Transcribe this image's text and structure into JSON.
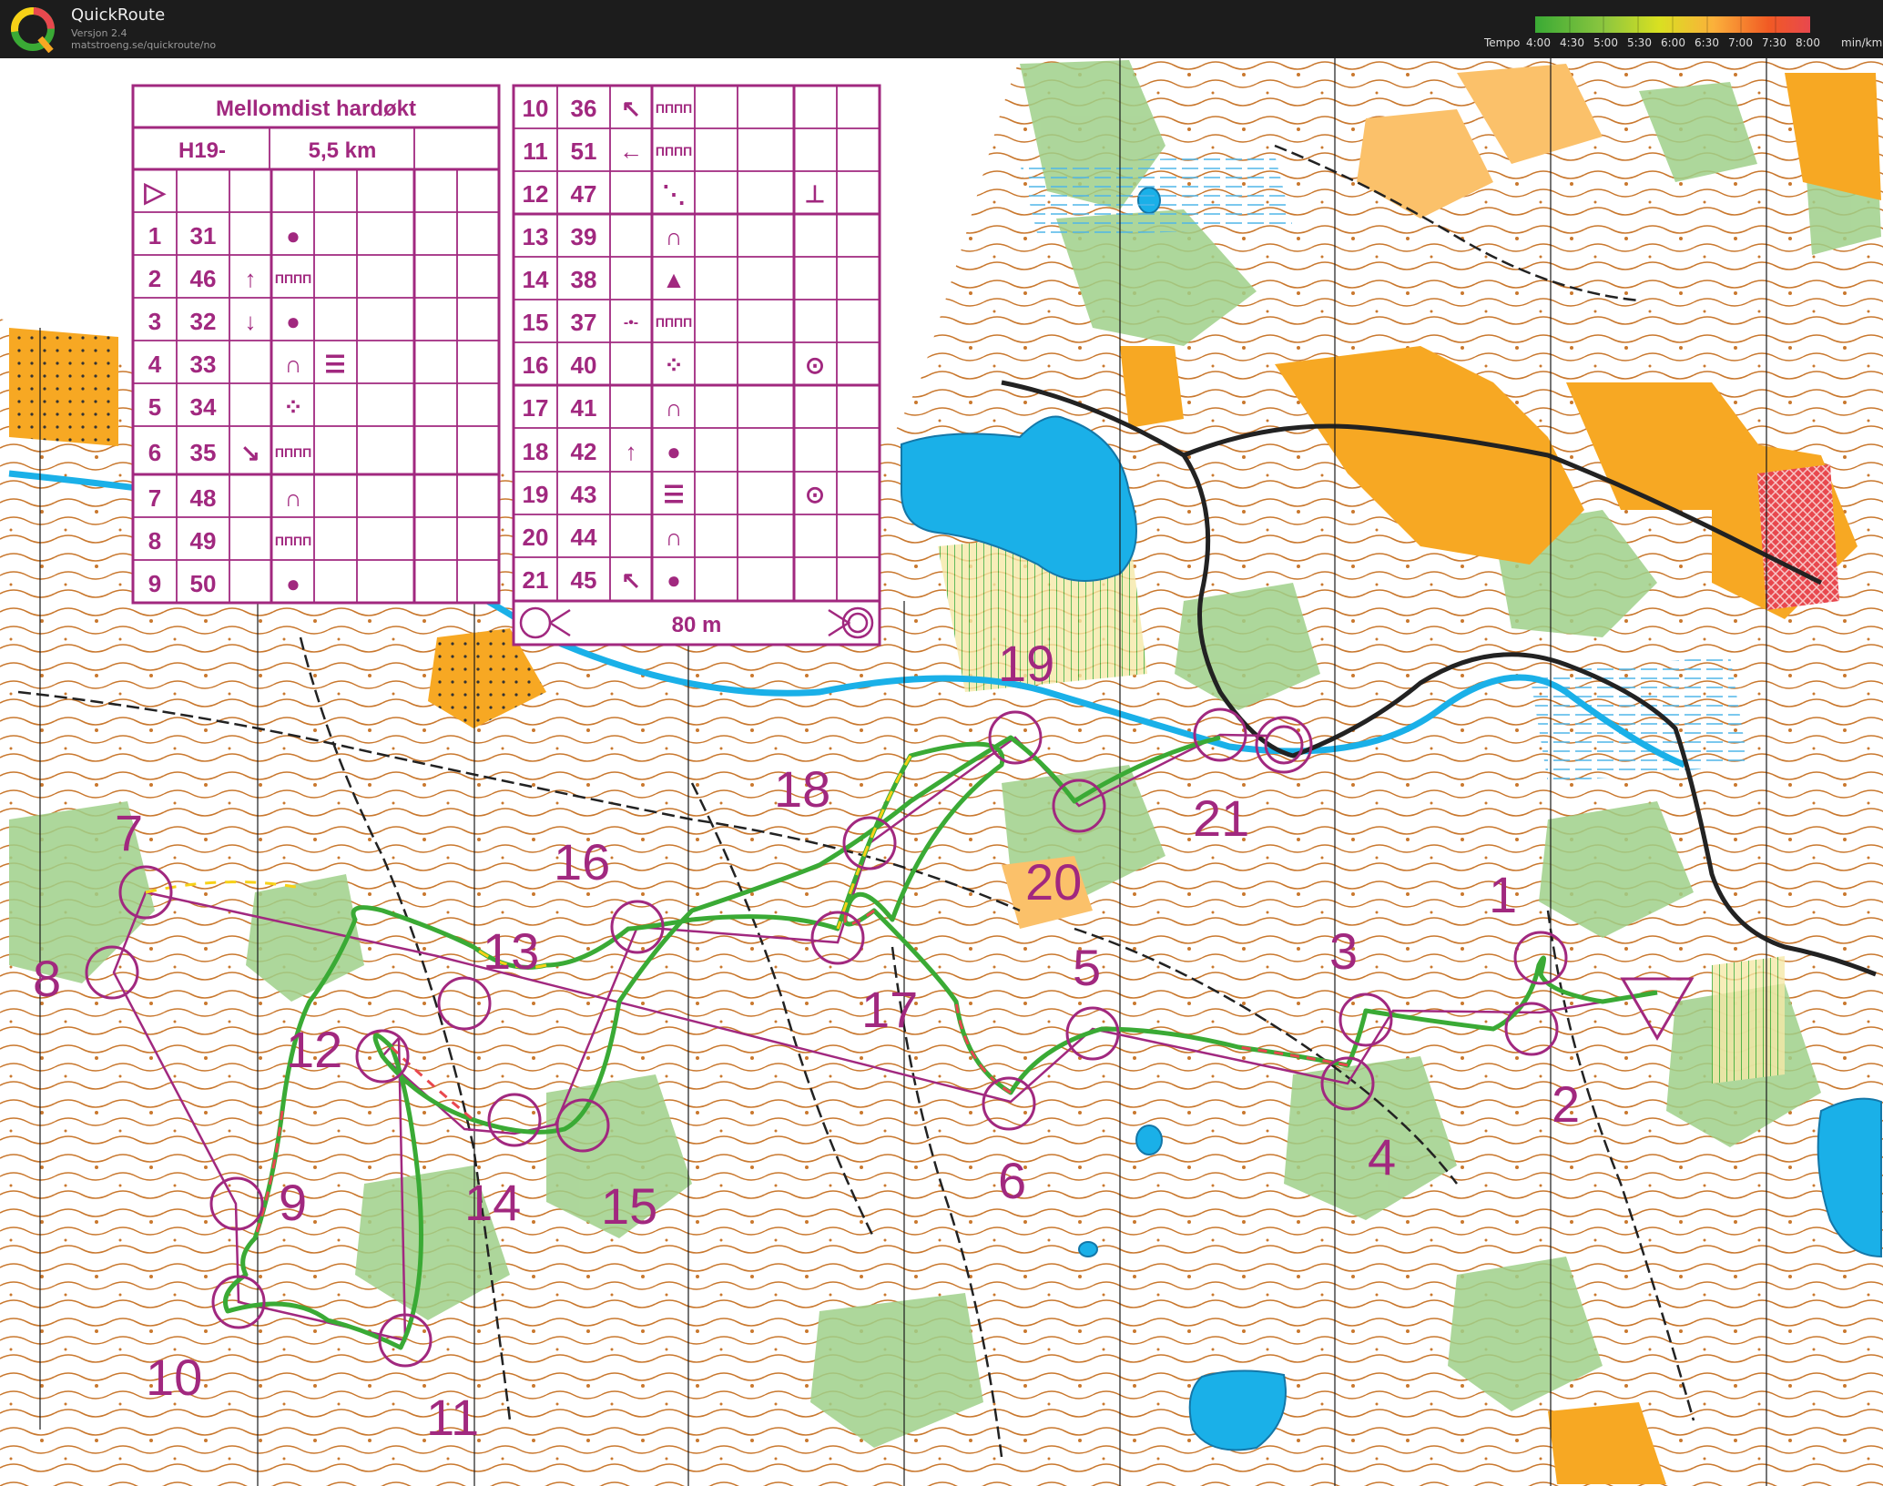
{
  "app": {
    "title": "QuickRoute",
    "version": "Versjon 2.4",
    "url": "matstroeng.se/quickroute/no"
  },
  "tempo_legend": {
    "label": "Tempo",
    "ticks": [
      "4:00",
      "4:30",
      "5:00",
      "5:30",
      "6:00",
      "6:30",
      "7:00",
      "7:30",
      "8:00"
    ],
    "unit": "min/km",
    "colors": [
      "#3aaa35",
      "#8cc63f",
      "#d9e021",
      "#fbb03b",
      "#f15a24",
      "#e8484e"
    ]
  },
  "colors": {
    "course": "#a1287f",
    "route_fast": "#3aaa35",
    "route_slow": "#e8484e",
    "water": "#1ab0e8",
    "open_land": "#f7a823",
    "vegetation": "#9fd08a",
    "contour": "#b5651d"
  },
  "description_sheet": {
    "title": "Mellomdist hardøkt",
    "class": "H19-",
    "length": "5,5 km",
    "start_symbol": "▷",
    "controls_left": [
      {
        "num": "1",
        "code": "31",
        "dir": "",
        "feature": "●",
        "detail": ""
      },
      {
        "num": "2",
        "code": "46",
        "dir": "↑",
        "feature": "ПППП",
        "detail": ""
      },
      {
        "num": "3",
        "code": "32",
        "dir": "↓",
        "feature": "●",
        "detail": ""
      },
      {
        "num": "4",
        "code": "33",
        "dir": "",
        "feature": "∩",
        "detail": "☰"
      },
      {
        "num": "5",
        "code": "34",
        "dir": "",
        "feature": "⁘",
        "detail": ""
      },
      {
        "num": "6",
        "code": "35",
        "dir": "↘",
        "feature": "ПППП",
        "detail": ""
      },
      {
        "num": "7",
        "code": "48",
        "dir": "",
        "feature": "∩",
        "detail": ""
      },
      {
        "num": "8",
        "code": "49",
        "dir": "",
        "feature": "ПППП",
        "detail": ""
      },
      {
        "num": "9",
        "code": "50",
        "dir": "",
        "feature": "●",
        "detail": ""
      }
    ],
    "controls_right": [
      {
        "num": "10",
        "code": "36",
        "dir": "↖",
        "feature": "ПППП",
        "extra": ""
      },
      {
        "num": "11",
        "code": "51",
        "dir": "←",
        "feature": "ПППП",
        "extra": ""
      },
      {
        "num": "12",
        "code": "47",
        "dir": "",
        "feature": "⋱",
        "extra": "⊥"
      },
      {
        "num": "13",
        "code": "39",
        "dir": "",
        "feature": "∩",
        "extra": ""
      },
      {
        "num": "14",
        "code": "38",
        "dir": "",
        "feature": "▲",
        "extra": ""
      },
      {
        "num": "15",
        "code": "37",
        "dir": "-•-",
        "feature": "ПППП",
        "extra": ""
      },
      {
        "num": "16",
        "code": "40",
        "dir": "",
        "feature": "⁘",
        "extra": "⊙"
      },
      {
        "num": "17",
        "code": "41",
        "dir": "",
        "feature": "∩",
        "extra": ""
      },
      {
        "num": "18",
        "code": "42",
        "dir": "↑",
        "feature": "●",
        "extra": ""
      },
      {
        "num": "19",
        "code": "43",
        "dir": "",
        "feature": "☰",
        "extra": "⊙"
      },
      {
        "num": "20",
        "code": "44",
        "dir": "",
        "feature": "∩",
        "extra": ""
      },
      {
        "num": "21",
        "code": "45",
        "dir": "↖",
        "feature": "●",
        "extra": ""
      }
    ],
    "finish_distance": "80 m"
  },
  "course_labels": [
    "1",
    "2",
    "3",
    "4",
    "5",
    "6",
    "7",
    "8",
    "9",
    "10",
    "11",
    "12",
    "13",
    "14",
    "15",
    "16",
    "17",
    "18",
    "19",
    "20",
    "21"
  ]
}
